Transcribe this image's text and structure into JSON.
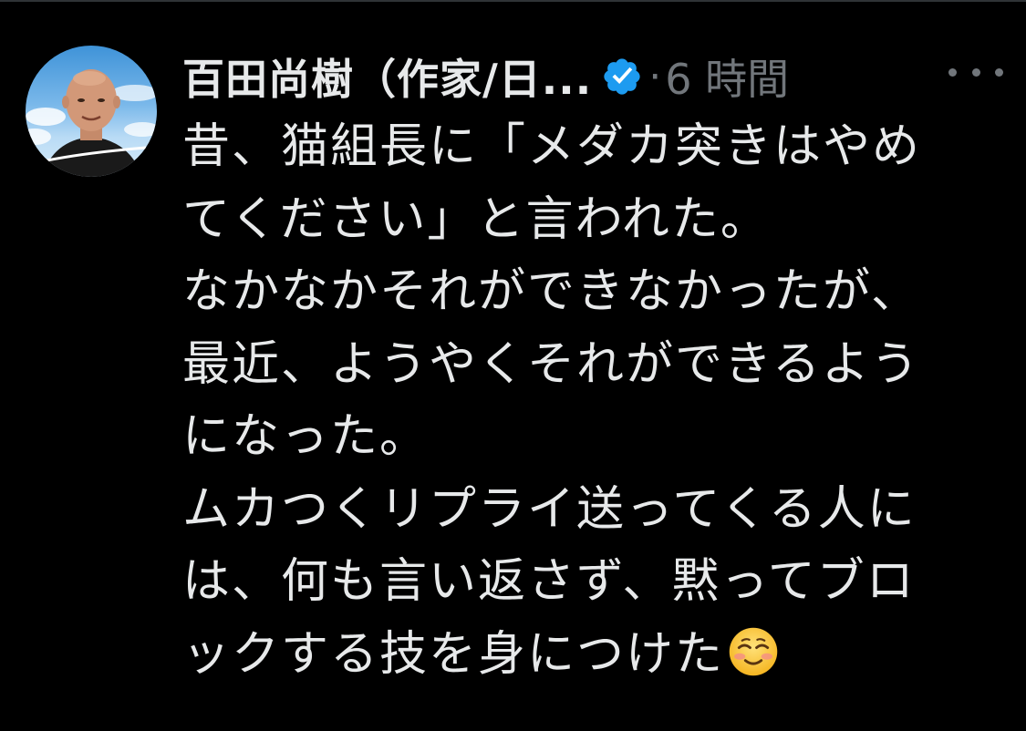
{
  "post": {
    "display_name": "百田尚樹（作家/日...",
    "separator": "·",
    "timestamp": "6 時間",
    "avatar_signature": "百田尚樹",
    "verified": true,
    "lines": [
      "昔、猫組長に「メダカ突きはやめ",
      "てください」と言われた。",
      "なかなかそれができなかったが、",
      "最近、ようやくそれができるよう",
      "になった。",
      "ムカつくリプライ送ってくる人に",
      "は、何も言い返さず、黙ってブロ",
      "ックする技を身につけた"
    ],
    "emoji": "smiling-face-emoji"
  },
  "colors": {
    "background": "#000000",
    "text": "#e7e9ea",
    "muted": "#71767b",
    "verified_blue": "#1d9bf0"
  }
}
